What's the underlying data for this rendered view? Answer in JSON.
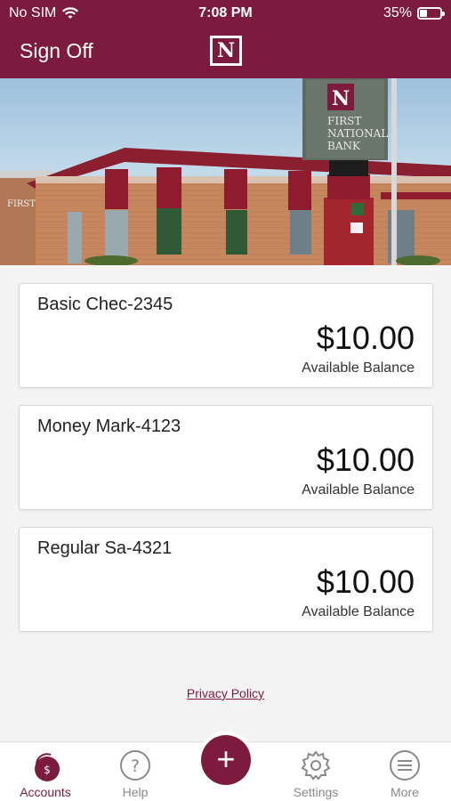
{
  "status_bar": {
    "carrier": "No SIM",
    "time": "7:08 PM",
    "battery_percent": "35%",
    "battery_level": 0.35
  },
  "header": {
    "sign_off_label": "Sign Off",
    "logo_text": "N"
  },
  "hero": {
    "sign_lines": [
      "FIRST",
      "NATIONAL",
      "BANK"
    ],
    "side_sign": "FIRST"
  },
  "accounts": [
    {
      "name": "Basic Chec-2345",
      "balance": "$10.00",
      "balance_label": "Available Balance"
    },
    {
      "name": "Money Mark-4123",
      "balance": "$10.00",
      "balance_label": "Available Balance"
    },
    {
      "name": "Regular Sa-4321",
      "balance": "$10.00",
      "balance_label": "Available Balance"
    }
  ],
  "footer": {
    "privacy_link": "Privacy Policy"
  },
  "tabs": [
    {
      "label": "Accounts",
      "icon": "dollar-icon",
      "active": true
    },
    {
      "label": "Help",
      "icon": "question-icon",
      "active": false
    },
    {
      "label": "",
      "icon": "plus-icon",
      "active": false
    },
    {
      "label": "Settings",
      "icon": "gear-icon",
      "active": false
    },
    {
      "label": "More",
      "icon": "menu-icon",
      "active": false
    }
  ],
  "colors": {
    "brand": "#7d1b3e",
    "background": "#f4f4f4",
    "tab_inactive": "#8a8a8a"
  }
}
